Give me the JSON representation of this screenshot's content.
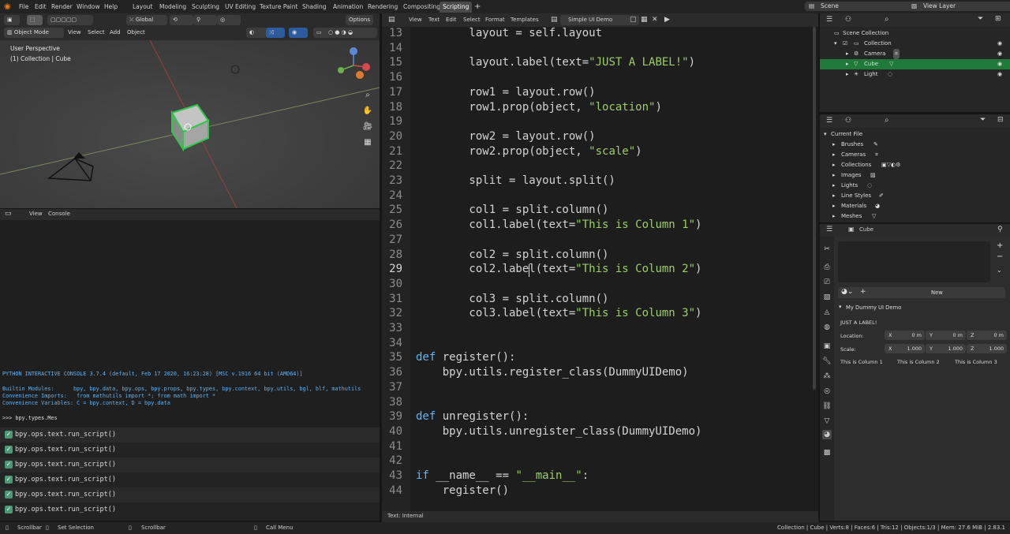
{
  "topbar": {
    "menus": [
      "File",
      "Edit",
      "Render",
      "Window",
      "Help"
    ],
    "workspaces": [
      "Layout",
      "Modeling",
      "Sculpting",
      "UV Editing",
      "Texture Paint",
      "Shading",
      "Animation",
      "Rendering",
      "Compositing",
      "Scripting"
    ],
    "active_workspace": "Scripting",
    "add_tab": "+",
    "scene": "Scene",
    "view_layer": "View Layer"
  },
  "viewport": {
    "transform_orientation": "Global",
    "options": "Options",
    "mode": "Object Mode",
    "menus": [
      "View",
      "Select",
      "Add",
      "Object"
    ],
    "perspective": "User Perspective",
    "collection_info": "(1) Collection | Cube",
    "gizmo": {
      "x": "X",
      "y": "Y",
      "z": "Z"
    }
  },
  "console": {
    "header_menus": [
      "View",
      "Console"
    ],
    "lines": [
      "PYTHON INTERACTIVE CONSOLE 3.7.4 (default, Feb 17 2020, 16:23:28) [MSC v.1916 64 bit (AMD64)]",
      "Builtin Modules:      bpy, bpy.data, bpy.ops, bpy.props, bpy.types, bpy.context, bpy.utils, bgl, blf, mathutils",
      "Convenience Imports:   from mathutils import *; from math import *",
      "Convenience Variables: C = bpy.context, D = bpy.data"
    ],
    "prompt": ">>> bpy.types.Mes"
  },
  "info_log": [
    "bpy.ops.text.run_script()",
    "bpy.ops.text.run_script()",
    "bpy.ops.text.run_script()",
    "bpy.ops.text.run_script()",
    "bpy.ops.text.run_script()",
    "bpy.ops.text.run_script()"
  ],
  "text_editor": {
    "menus": [
      "View",
      "Text",
      "Edit",
      "Select",
      "Format",
      "Templates"
    ],
    "file_name": "Simple UI Demo",
    "footer": "Text: Internal",
    "current_line": 29,
    "lines": [
      {
        "n": "13",
        "parts": [
          [
            "        layout = self.layout",
            ""
          ]
        ]
      },
      {
        "n": "14",
        "parts": []
      },
      {
        "n": "15",
        "parts": [
          [
            "        layout.label(text=",
            ""
          ],
          [
            "\"JUST A LABEL!\"",
            "st"
          ],
          [
            ")",
            ""
          ]
        ]
      },
      {
        "n": "16",
        "parts": []
      },
      {
        "n": "17",
        "parts": [
          [
            "        row1 = layout.row()",
            ""
          ]
        ]
      },
      {
        "n": "18",
        "parts": [
          [
            "        row1.prop(object, ",
            ""
          ],
          [
            "\"location\"",
            "st"
          ],
          [
            ")",
            ""
          ]
        ]
      },
      {
        "n": "19",
        "parts": []
      },
      {
        "n": "20",
        "parts": [
          [
            "        row2 = layout.row()",
            ""
          ]
        ]
      },
      {
        "n": "21",
        "parts": [
          [
            "        row2.prop(object, ",
            ""
          ],
          [
            "\"scale\"",
            "st"
          ],
          [
            ")",
            ""
          ]
        ]
      },
      {
        "n": "22",
        "parts": []
      },
      {
        "n": "23",
        "parts": [
          [
            "        split = layout.split()",
            ""
          ]
        ]
      },
      {
        "n": "24",
        "parts": []
      },
      {
        "n": "25",
        "parts": [
          [
            "        col1 = split.column()",
            ""
          ]
        ]
      },
      {
        "n": "26",
        "parts": [
          [
            "        col1.label(text=",
            ""
          ],
          [
            "\"This is Column 1\"",
            "st"
          ],
          [
            ")",
            ""
          ]
        ]
      },
      {
        "n": "27",
        "parts": []
      },
      {
        "n": "28",
        "parts": [
          [
            "        col2 = split.column()",
            ""
          ]
        ]
      },
      {
        "n": "29",
        "parts": [
          [
            "        col2.label(text=",
            ""
          ],
          [
            "\"This is Column 2\"",
            "st"
          ],
          [
            ")",
            ""
          ]
        ]
      },
      {
        "n": "30",
        "parts": []
      },
      {
        "n": "31",
        "parts": [
          [
            "        col3 = split.column()",
            ""
          ]
        ]
      },
      {
        "n": "32",
        "parts": [
          [
            "        col3.label(text=",
            ""
          ],
          [
            "\"This is Column 3\"",
            "st"
          ],
          [
            ")",
            ""
          ]
        ]
      },
      {
        "n": "33",
        "parts": []
      },
      {
        "n": "34",
        "parts": []
      },
      {
        "n": "35",
        "parts": [
          [
            "def",
            "kw"
          ],
          [
            " register():",
            ""
          ]
        ]
      },
      {
        "n": "36",
        "parts": [
          [
            "    bpy.utils.register_class(DummyUIDemo)",
            ""
          ]
        ]
      },
      {
        "n": "37",
        "parts": []
      },
      {
        "n": "38",
        "parts": []
      },
      {
        "n": "39",
        "parts": [
          [
            "def",
            "kw"
          ],
          [
            " unregister():",
            ""
          ]
        ]
      },
      {
        "n": "40",
        "parts": [
          [
            "    bpy.utils.unregister_class(DummyUIDemo)",
            ""
          ]
        ]
      },
      {
        "n": "41",
        "parts": []
      },
      {
        "n": "42",
        "parts": []
      },
      {
        "n": "43",
        "parts": [
          [
            "if",
            "kw"
          ],
          [
            " __name__ == ",
            ""
          ],
          [
            "\"__main__\"",
            "st"
          ],
          [
            ":",
            ""
          ]
        ]
      },
      {
        "n": "44",
        "parts": [
          [
            "    register()",
            ""
          ]
        ]
      }
    ]
  },
  "outliner": {
    "items": [
      {
        "label": "Scene Collection",
        "indent": 0,
        "selected": false
      },
      {
        "label": "Collection",
        "indent": 1,
        "selected": false
      },
      {
        "label": "Camera",
        "indent": 2,
        "selected": false
      },
      {
        "label": "Cube",
        "indent": 2,
        "selected": true
      },
      {
        "label": "Light",
        "indent": 2,
        "selected": false
      }
    ]
  },
  "file_browser": {
    "root": "Current File",
    "items": [
      "Brushes",
      "Cameras",
      "Collections",
      "Images",
      "Lights",
      "Line Styles",
      "Materials",
      "Meshes"
    ]
  },
  "properties": {
    "object_name": "Cube",
    "new_button": "New",
    "panel_title": "My Dummy UI Demo",
    "label": "JUST A LABEL!",
    "location_label": "Location:",
    "location": [
      {
        "axis": "X",
        "value": "0 m"
      },
      {
        "axis": "Y",
        "value": "0 m"
      },
      {
        "axis": "Z",
        "value": "0 m"
      }
    ],
    "scale_label": "Scale:",
    "scale": [
      {
        "axis": "X",
        "value": "1.000"
      },
      {
        "axis": "Y",
        "value": "1.000"
      },
      {
        "axis": "Z",
        "value": "1.000"
      }
    ],
    "columns": [
      "This is Column 1",
      "This is Column 2",
      "This is Column 3"
    ]
  },
  "statusbar": {
    "items": [
      "Scrollbar",
      "Set Selection",
      "Scrollbar",
      "Call Menu"
    ],
    "stats": "Collection | Cube | Verts:8 | Faces:6 | Tris:12 | Objects:1/3 | Mem: 27.6 MiB | 2.83.1"
  }
}
